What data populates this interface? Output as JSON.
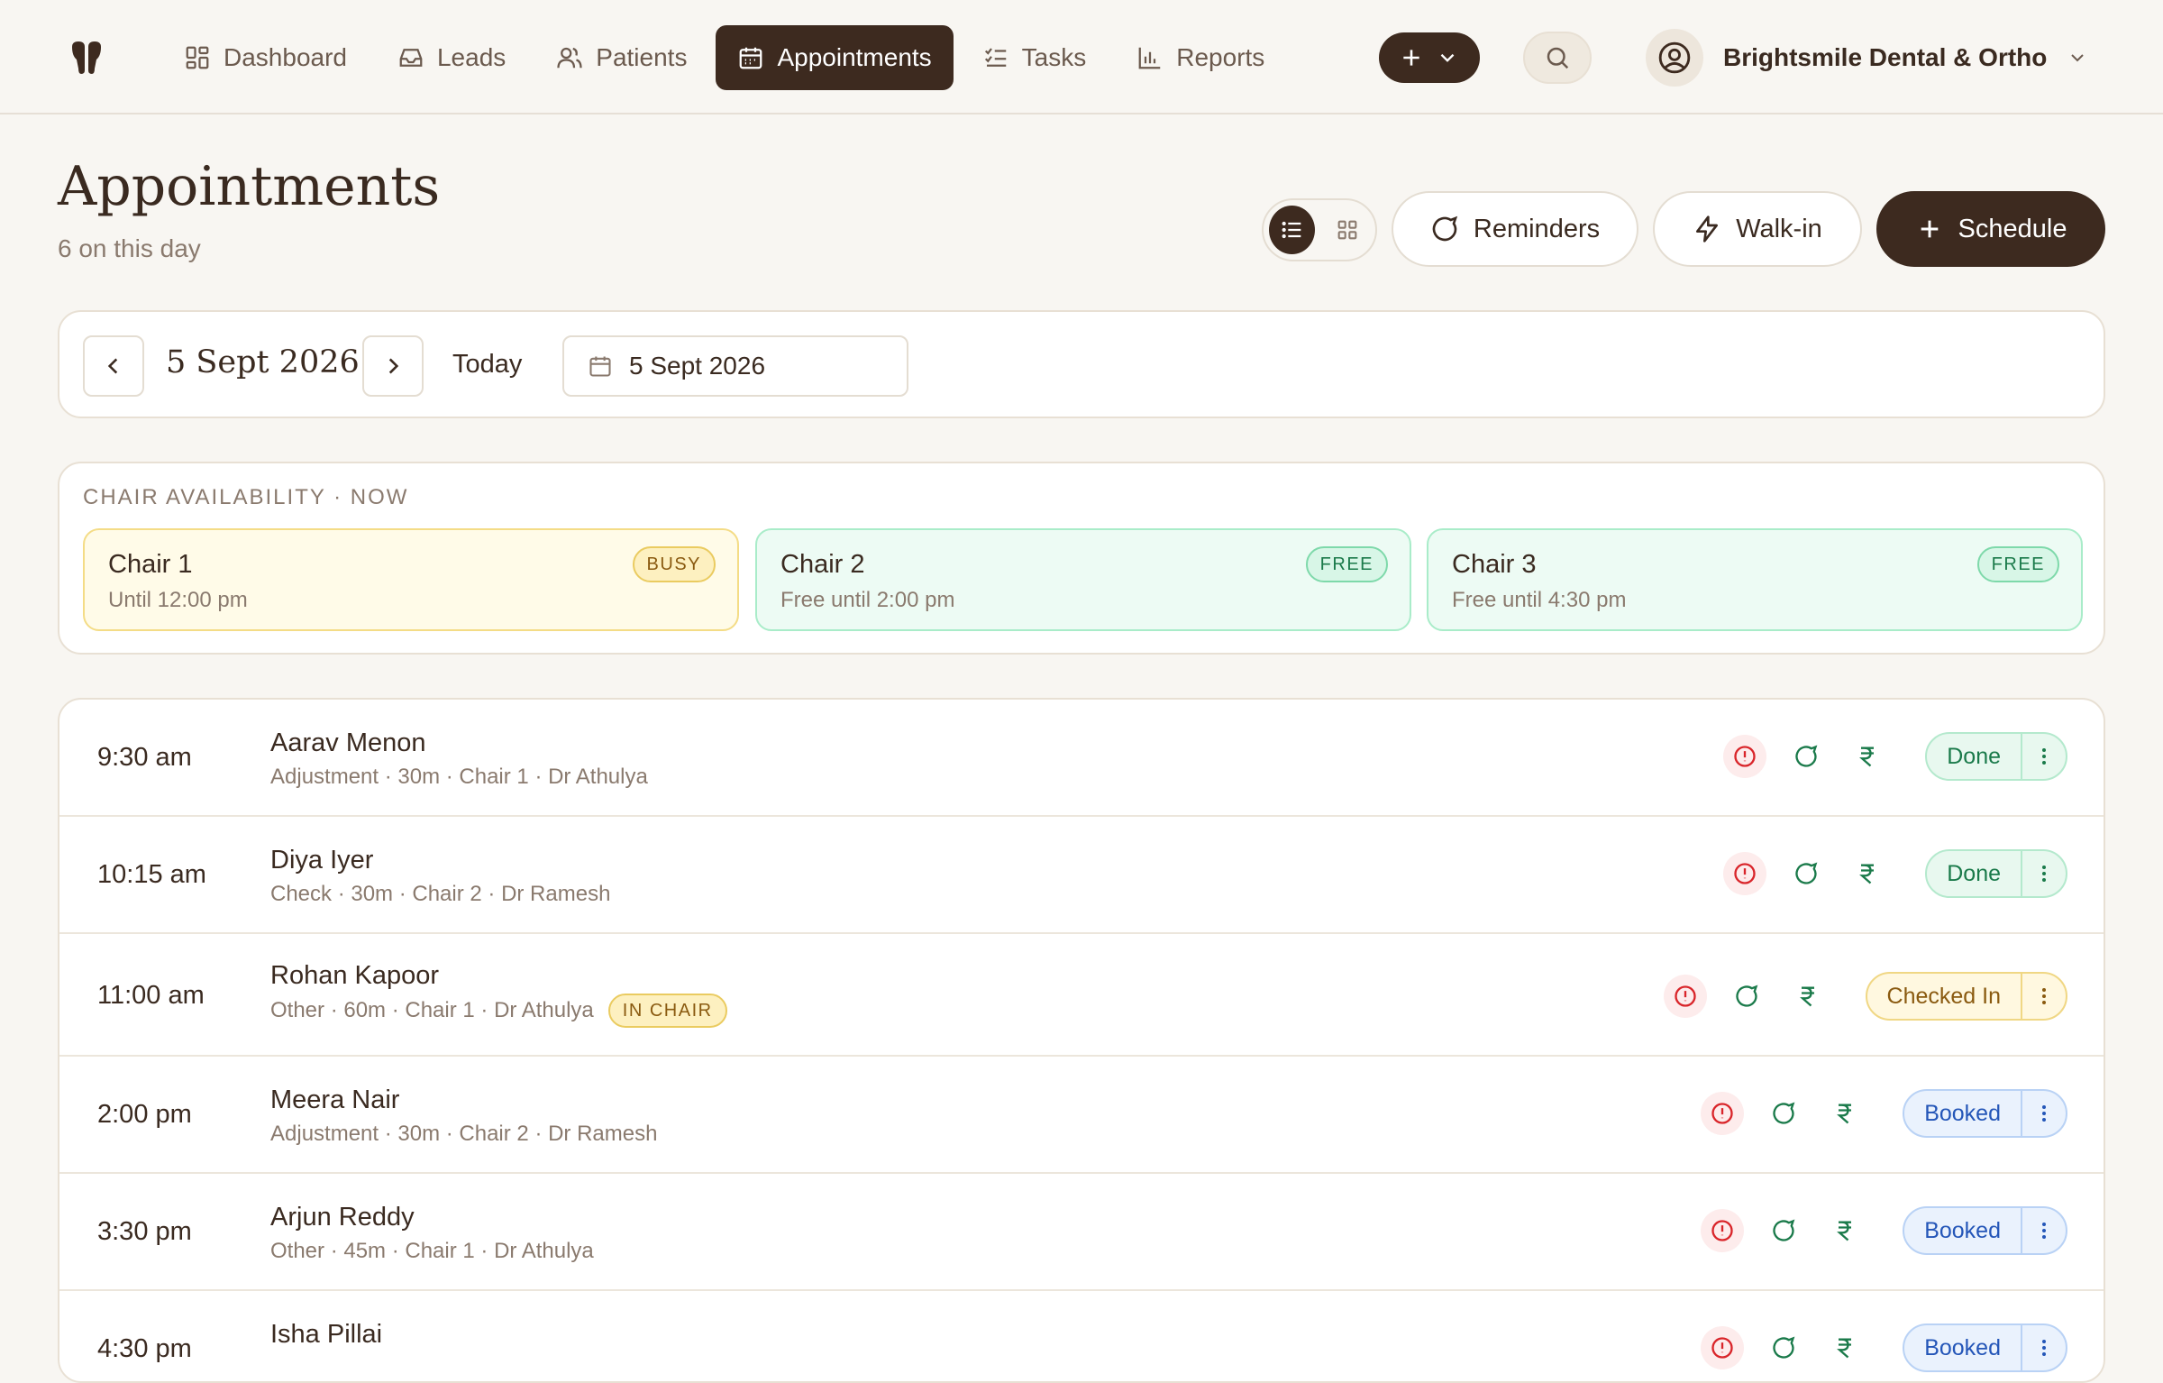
{
  "nav": {
    "items": [
      {
        "label": "Dashboard",
        "icon": "dashboard-icon"
      },
      {
        "label": "Leads",
        "icon": "inbox-icon"
      },
      {
        "label": "Patients",
        "icon": "users-icon"
      },
      {
        "label": "Appointments",
        "icon": "calendar-icon",
        "active": true
      },
      {
        "label": "Tasks",
        "icon": "checklist-icon"
      },
      {
        "label": "Reports",
        "icon": "bar-chart-icon"
      }
    ],
    "org_name": "Brightsmile Dental & Ortho"
  },
  "page": {
    "title": "Appointments",
    "subtitle": "6 on this day"
  },
  "actions": {
    "reminders": "Reminders",
    "walkin": "Walk-in",
    "schedule": "Schedule"
  },
  "datebar": {
    "current_date": "5 Sept 2026",
    "today": "Today",
    "picker_value": "5 Sept 2026"
  },
  "chairs": {
    "heading": "CHAIR AVAILABILITY · NOW",
    "items": [
      {
        "name": "Chair 1",
        "until": "Until 12:00 pm",
        "badge": "BUSY",
        "state": "busy"
      },
      {
        "name": "Chair 2",
        "until": "Free until 2:00 pm",
        "badge": "FREE",
        "state": "free"
      },
      {
        "name": "Chair 3",
        "until": "Free until 4:30 pm",
        "badge": "FREE",
        "state": "free"
      }
    ]
  },
  "appointments": [
    {
      "time": "9:30 am",
      "patient": "Aarav Menon",
      "detail": "Adjustment · 30m · Chair 1 · Dr Athulya",
      "status": "Done",
      "tag": ""
    },
    {
      "time": "10:15 am",
      "patient": "Diya Iyer",
      "detail": "Check · 30m · Chair 2 · Dr Ramesh",
      "status": "Done",
      "tag": ""
    },
    {
      "time": "11:00 am",
      "patient": "Rohan Kapoor",
      "detail": "Other · 60m · Chair 1 · Dr Athulya",
      "status": "Checked In",
      "tag": "IN CHAIR"
    },
    {
      "time": "2:00 pm",
      "patient": "Meera Nair",
      "detail": "Adjustment · 30m · Chair 2 · Dr Ramesh",
      "status": "Booked",
      "tag": ""
    },
    {
      "time": "3:30 pm",
      "patient": "Arjun Reddy",
      "detail": "Other · 45m · Chair 1 · Dr Athulya",
      "status": "Booked",
      "tag": ""
    },
    {
      "time": "4:30 pm",
      "patient": "Isha Pillai",
      "detail": "",
      "status": "Booked",
      "tag": ""
    }
  ],
  "colors": {
    "brand_dark": "#3d2a1f",
    "background": "#f8f6f2",
    "done": "#1a7a4a",
    "checked_in": "#8a5a10",
    "booked": "#2456b8",
    "alert": "#d9252a"
  }
}
